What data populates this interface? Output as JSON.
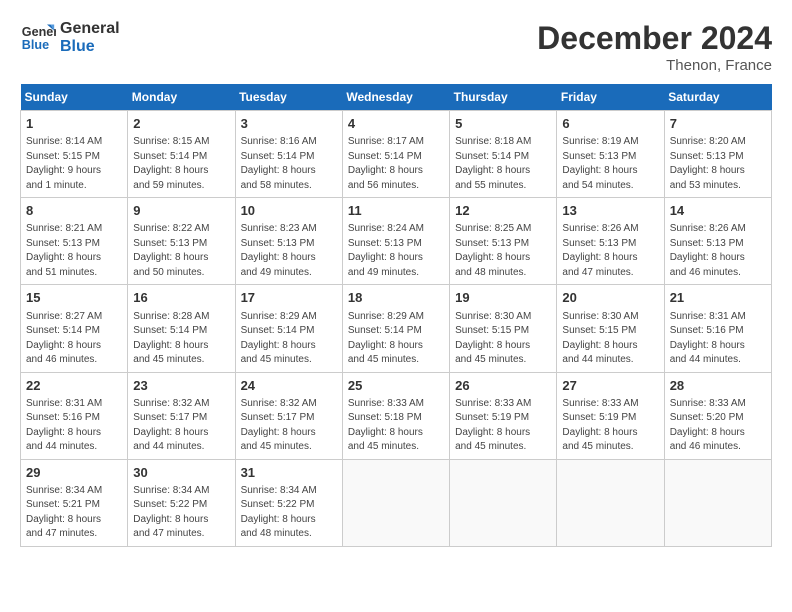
{
  "logo": {
    "line1": "General",
    "line2": "Blue"
  },
  "title": "December 2024",
  "location": "Thenon, France",
  "days_of_week": [
    "Sunday",
    "Monday",
    "Tuesday",
    "Wednesday",
    "Thursday",
    "Friday",
    "Saturday"
  ],
  "weeks": [
    [
      {
        "day": 1,
        "info": "Sunrise: 8:14 AM\nSunset: 5:15 PM\nDaylight: 9 hours\nand 1 minute."
      },
      {
        "day": 2,
        "info": "Sunrise: 8:15 AM\nSunset: 5:14 PM\nDaylight: 8 hours\nand 59 minutes."
      },
      {
        "day": 3,
        "info": "Sunrise: 8:16 AM\nSunset: 5:14 PM\nDaylight: 8 hours\nand 58 minutes."
      },
      {
        "day": 4,
        "info": "Sunrise: 8:17 AM\nSunset: 5:14 PM\nDaylight: 8 hours\nand 56 minutes."
      },
      {
        "day": 5,
        "info": "Sunrise: 8:18 AM\nSunset: 5:14 PM\nDaylight: 8 hours\nand 55 minutes."
      },
      {
        "day": 6,
        "info": "Sunrise: 8:19 AM\nSunset: 5:13 PM\nDaylight: 8 hours\nand 54 minutes."
      },
      {
        "day": 7,
        "info": "Sunrise: 8:20 AM\nSunset: 5:13 PM\nDaylight: 8 hours\nand 53 minutes."
      }
    ],
    [
      {
        "day": 8,
        "info": "Sunrise: 8:21 AM\nSunset: 5:13 PM\nDaylight: 8 hours\nand 51 minutes."
      },
      {
        "day": 9,
        "info": "Sunrise: 8:22 AM\nSunset: 5:13 PM\nDaylight: 8 hours\nand 50 minutes."
      },
      {
        "day": 10,
        "info": "Sunrise: 8:23 AM\nSunset: 5:13 PM\nDaylight: 8 hours\nand 49 minutes."
      },
      {
        "day": 11,
        "info": "Sunrise: 8:24 AM\nSunset: 5:13 PM\nDaylight: 8 hours\nand 49 minutes."
      },
      {
        "day": 12,
        "info": "Sunrise: 8:25 AM\nSunset: 5:13 PM\nDaylight: 8 hours\nand 48 minutes."
      },
      {
        "day": 13,
        "info": "Sunrise: 8:26 AM\nSunset: 5:13 PM\nDaylight: 8 hours\nand 47 minutes."
      },
      {
        "day": 14,
        "info": "Sunrise: 8:26 AM\nSunset: 5:13 PM\nDaylight: 8 hours\nand 46 minutes."
      }
    ],
    [
      {
        "day": 15,
        "info": "Sunrise: 8:27 AM\nSunset: 5:14 PM\nDaylight: 8 hours\nand 46 minutes."
      },
      {
        "day": 16,
        "info": "Sunrise: 8:28 AM\nSunset: 5:14 PM\nDaylight: 8 hours\nand 45 minutes."
      },
      {
        "day": 17,
        "info": "Sunrise: 8:29 AM\nSunset: 5:14 PM\nDaylight: 8 hours\nand 45 minutes."
      },
      {
        "day": 18,
        "info": "Sunrise: 8:29 AM\nSunset: 5:14 PM\nDaylight: 8 hours\nand 45 minutes."
      },
      {
        "day": 19,
        "info": "Sunrise: 8:30 AM\nSunset: 5:15 PM\nDaylight: 8 hours\nand 45 minutes."
      },
      {
        "day": 20,
        "info": "Sunrise: 8:30 AM\nSunset: 5:15 PM\nDaylight: 8 hours\nand 44 minutes."
      },
      {
        "day": 21,
        "info": "Sunrise: 8:31 AM\nSunset: 5:16 PM\nDaylight: 8 hours\nand 44 minutes."
      }
    ],
    [
      {
        "day": 22,
        "info": "Sunrise: 8:31 AM\nSunset: 5:16 PM\nDaylight: 8 hours\nand 44 minutes."
      },
      {
        "day": 23,
        "info": "Sunrise: 8:32 AM\nSunset: 5:17 PM\nDaylight: 8 hours\nand 44 minutes."
      },
      {
        "day": 24,
        "info": "Sunrise: 8:32 AM\nSunset: 5:17 PM\nDaylight: 8 hours\nand 45 minutes."
      },
      {
        "day": 25,
        "info": "Sunrise: 8:33 AM\nSunset: 5:18 PM\nDaylight: 8 hours\nand 45 minutes."
      },
      {
        "day": 26,
        "info": "Sunrise: 8:33 AM\nSunset: 5:19 PM\nDaylight: 8 hours\nand 45 minutes."
      },
      {
        "day": 27,
        "info": "Sunrise: 8:33 AM\nSunset: 5:19 PM\nDaylight: 8 hours\nand 45 minutes."
      },
      {
        "day": 28,
        "info": "Sunrise: 8:33 AM\nSunset: 5:20 PM\nDaylight: 8 hours\nand 46 minutes."
      }
    ],
    [
      {
        "day": 29,
        "info": "Sunrise: 8:34 AM\nSunset: 5:21 PM\nDaylight: 8 hours\nand 47 minutes."
      },
      {
        "day": 30,
        "info": "Sunrise: 8:34 AM\nSunset: 5:22 PM\nDaylight: 8 hours\nand 47 minutes."
      },
      {
        "day": 31,
        "info": "Sunrise: 8:34 AM\nSunset: 5:22 PM\nDaylight: 8 hours\nand 48 minutes."
      },
      null,
      null,
      null,
      null
    ]
  ]
}
